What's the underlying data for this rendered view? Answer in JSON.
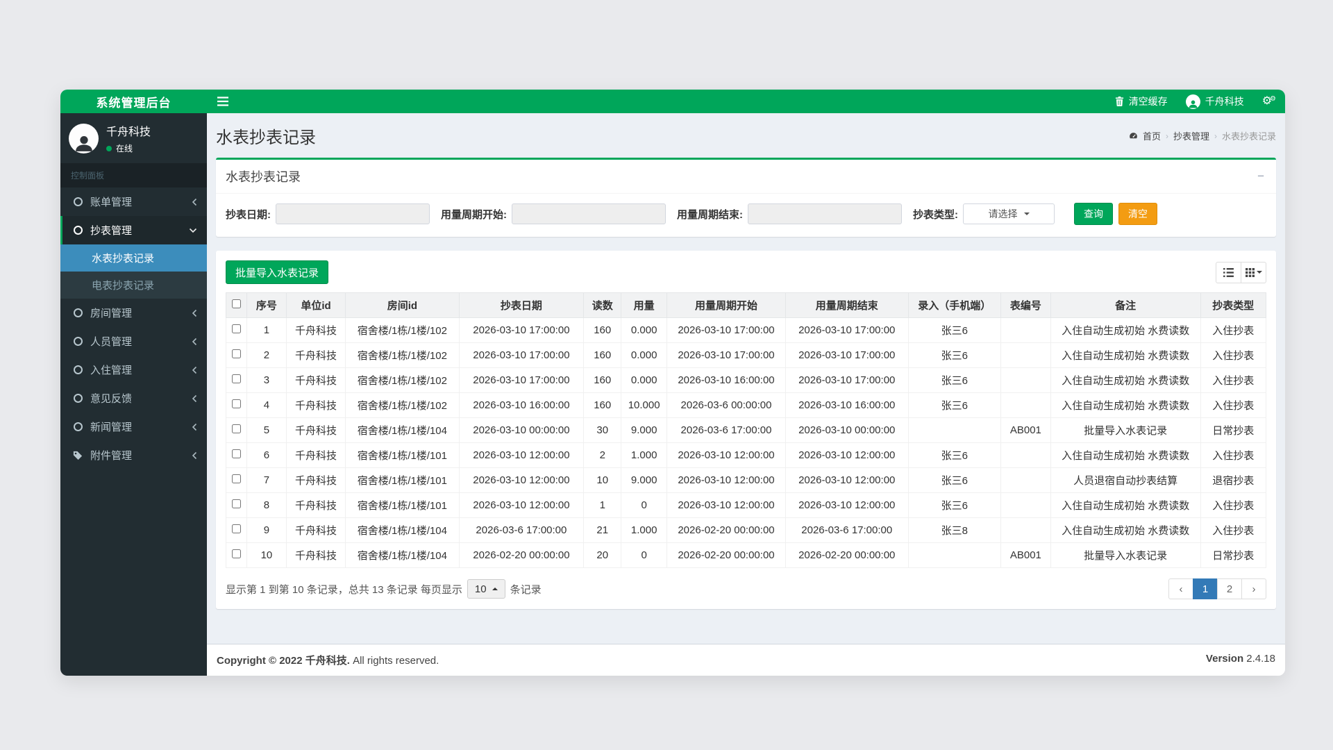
{
  "colors": {
    "brand_green": "#00a65a",
    "accent_orange": "#f39c12",
    "active_blue": "#3c8dbc",
    "pager_blue": "#337ab7",
    "sidebar_dark": "#222d32"
  },
  "topbar": {
    "logo": "系统管理后台",
    "clear_cache_label": "清空缓存",
    "user_name": "千舟科技"
  },
  "sidebar": {
    "user": {
      "name": "千舟科技",
      "status": "在线"
    },
    "section_label": "控制面板",
    "items": [
      {
        "label": "账单管理"
      },
      {
        "label": "抄表管理"
      },
      {
        "label": "房间管理"
      },
      {
        "label": "人员管理"
      },
      {
        "label": "入住管理"
      },
      {
        "label": "意见反馈"
      },
      {
        "label": "新闻管理"
      },
      {
        "label": "附件管理"
      }
    ],
    "submenu": [
      {
        "label": "水表抄表记录"
      },
      {
        "label": "电表抄表记录"
      }
    ]
  },
  "page": {
    "title": "水表抄表记录",
    "breadcrumb": [
      "首页",
      "抄表管理",
      "水表抄表记录"
    ]
  },
  "filter": {
    "box_title": "水表抄表记录",
    "labels": [
      "抄表日期:",
      "用量周期开始:",
      "用量周期结束:",
      "抄表类型:"
    ],
    "type_placeholder": "请选择",
    "search_label": "查询",
    "clear_label": "清空"
  },
  "toolbar": {
    "import_label": "批量导入水表记录"
  },
  "table": {
    "headers": [
      "序号",
      "单位id",
      "房间id",
      "抄表日期",
      "读数",
      "用量",
      "用量周期开始",
      "用量周期结束",
      "录入（手机端）",
      "表编号",
      "备注",
      "抄表类型"
    ],
    "rows": [
      [
        "1",
        "千舟科技",
        "宿舍楼/1栋/1楼/102",
        "2026-03-10 17:00:00",
        "160",
        "0.000",
        "2026-03-10 17:00:00",
        "2026-03-10 17:00:00",
        "张三6",
        "",
        "入住自动生成初始 水费读数",
        "入住抄表"
      ],
      [
        "2",
        "千舟科技",
        "宿舍楼/1栋/1楼/102",
        "2026-03-10 17:00:00",
        "160",
        "0.000",
        "2026-03-10 17:00:00",
        "2026-03-10 17:00:00",
        "张三6",
        "",
        "入住自动生成初始 水费读数",
        "入住抄表"
      ],
      [
        "3",
        "千舟科技",
        "宿舍楼/1栋/1楼/102",
        "2026-03-10 17:00:00",
        "160",
        "0.000",
        "2026-03-10 16:00:00",
        "2026-03-10 17:00:00",
        "张三6",
        "",
        "入住自动生成初始 水费读数",
        "入住抄表"
      ],
      [
        "4",
        "千舟科技",
        "宿舍楼/1栋/1楼/102",
        "2026-03-10 16:00:00",
        "160",
        "10.000",
        "2026-03-6 00:00:00",
        "2026-03-10 16:00:00",
        "张三6",
        "",
        "入住自动生成初始 水费读数",
        "入住抄表"
      ],
      [
        "5",
        "千舟科技",
        "宿舍楼/1栋/1楼/104",
        "2026-03-10 00:00:00",
        "30",
        "9.000",
        "2026-03-6 17:00:00",
        "2026-03-10 00:00:00",
        "",
        "AB001",
        "批量导入水表记录",
        "日常抄表"
      ],
      [
        "6",
        "千舟科技",
        "宿舍楼/1栋/1楼/101",
        "2026-03-10 12:00:00",
        "2",
        "1.000",
        "2026-03-10 12:00:00",
        "2026-03-10 12:00:00",
        "张三6",
        "",
        "入住自动生成初始 水费读数",
        "入住抄表"
      ],
      [
        "7",
        "千舟科技",
        "宿舍楼/1栋/1楼/101",
        "2026-03-10 12:00:00",
        "10",
        "9.000",
        "2026-03-10 12:00:00",
        "2026-03-10 12:00:00",
        "张三6",
        "",
        "人员退宿自动抄表结算",
        "退宿抄表"
      ],
      [
        "8",
        "千舟科技",
        "宿舍楼/1栋/1楼/101",
        "2026-03-10 12:00:00",
        "1",
        "0",
        "2026-03-10 12:00:00",
        "2026-03-10 12:00:00",
        "张三6",
        "",
        "入住自动生成初始 水费读数",
        "入住抄表"
      ],
      [
        "9",
        "千舟科技",
        "宿舍楼/1栋/1楼/104",
        "2026-03-6 17:00:00",
        "21",
        "1.000",
        "2026-02-20 00:00:00",
        "2026-03-6 17:00:00",
        "张三8",
        "",
        "入住自动生成初始 水费读数",
        "入住抄表"
      ],
      [
        "10",
        "千舟科技",
        "宿舍楼/1栋/1楼/104",
        "2026-02-20 00:00:00",
        "20",
        "0",
        "2026-02-20 00:00:00",
        "2026-02-20 00:00:00",
        "",
        "AB001",
        "批量导入水表记录",
        "日常抄表"
      ]
    ]
  },
  "pagination": {
    "summary_prefix": "显示第 1 到第 10 条记录，总共 13 条记录  每页显示",
    "page_size": "10",
    "summary_suffix": "条记录",
    "pages": [
      "1",
      "2"
    ],
    "prev": "‹",
    "next": "›"
  },
  "footer": {
    "copyright_strong": "Copyright © 2022 千舟科技.",
    "copyright_rest": " All rights reserved.",
    "version_label": "Version",
    "version_value": " 2.4.18"
  }
}
